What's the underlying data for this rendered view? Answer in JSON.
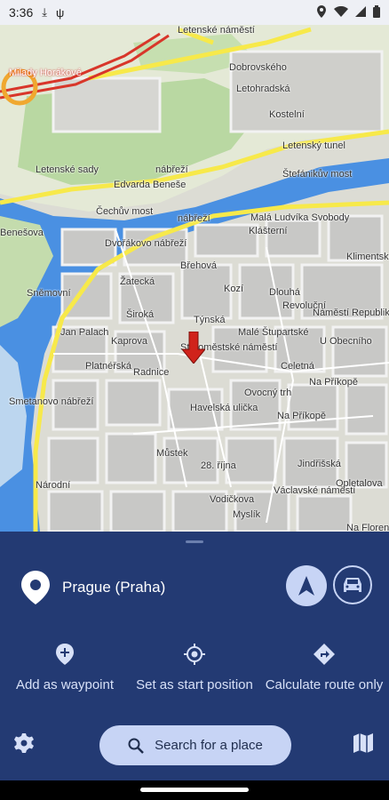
{
  "status_bar": {
    "time": "3:36",
    "left_icons": [
      "download-icon",
      "usb-icon"
    ],
    "right_icons": [
      "location-icon",
      "wifi-icon",
      "signal-icon",
      "battery-icon"
    ]
  },
  "map": {
    "labels": [
      "Letenské náměstí",
      "Milady Horákové",
      "Dobrovského",
      "Letohradská",
      "Kostelní",
      "Letenský tunel",
      "Štefánikův most",
      "Letenské sady",
      "nábřeží",
      "Edvarda Beneše",
      "Čechův most",
      "Dvořákovo nábřeží",
      "nábřeží",
      "Malá Ludvíka Svobody",
      "Klášterní",
      "Široká",
      "Břehová",
      "Kaprova",
      "Staroměstské náměstí",
      "Týnská",
      "Dlouhá",
      "Malé Štupartské",
      "Revoluční",
      "Náměstí Republiky",
      "Celetná",
      "Na Příkopě",
      "Platnéřská",
      "Radnice",
      "Smetanovo nábřeží",
      "Havelská ulička",
      "Ovocný trh",
      "Na Příkopě",
      "Národní",
      "Jindřišská",
      "Václavské náměstí",
      "Myslík",
      "Opletalova",
      "Můstek",
      "28. října",
      "Na Florenci",
      "Žatecká",
      "Kozí",
      "U Obecního",
      "Sněmovní",
      "Jan Palach",
      "Vodičkova",
      "Benešova",
      "Klimentská"
    ]
  },
  "place": {
    "name": "Prague (Praha)"
  },
  "actions": [
    {
      "label": "Add as waypoint",
      "icon": "add-waypoint-icon"
    },
    {
      "label": "Set as start position",
      "icon": "set-start-icon"
    },
    {
      "label": "Calculate route only",
      "icon": "route-icon"
    }
  ],
  "search": {
    "label": "Search for a place"
  },
  "colors": {
    "sheet": "#233a73",
    "button_light": "#c7d4f5",
    "river": "#4a90e2",
    "park": "#b8d9a3",
    "road_yellow": "#f7e94a",
    "road_red": "#d8362a",
    "marker": "#d0231b"
  }
}
